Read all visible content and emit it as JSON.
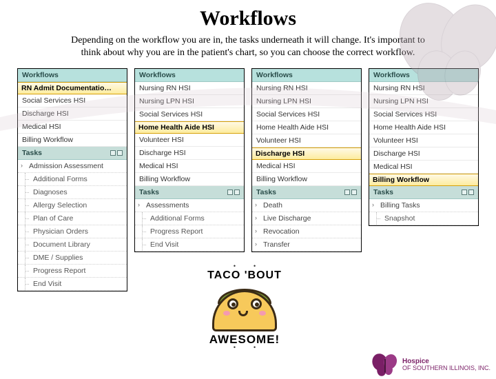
{
  "title": "Workflows",
  "subtitle": "Depending on the workflow you are in, the tasks underneath it will change. It's important to think about why you are in the patient's chart, so you can choose the correct workflow.",
  "labels": {
    "workflows": "Workflows",
    "tasks": "Tasks"
  },
  "panels": [
    {
      "workflows": [
        {
          "label": "RN Admit Documentatio…",
          "selected": true
        },
        {
          "label": "Social Services HSI"
        },
        {
          "label": "Discharge HSI"
        },
        {
          "label": "Medical HSI"
        },
        {
          "label": "Billing Workflow"
        }
      ],
      "tasks": [
        {
          "label": "Admission Assessment",
          "type": "caret"
        },
        {
          "label": "Additional Forms",
          "type": "sub"
        },
        {
          "label": "Diagnoses",
          "type": "sub"
        },
        {
          "label": "Allergy Selection",
          "type": "sub"
        },
        {
          "label": "Plan of Care",
          "type": "sub"
        },
        {
          "label": "Physician Orders",
          "type": "sub"
        },
        {
          "label": "Document Library",
          "type": "sub"
        },
        {
          "label": "DME / Supplies",
          "type": "sub"
        },
        {
          "label": "Progress Report",
          "type": "sub"
        },
        {
          "label": "End Visit",
          "type": "sub"
        }
      ]
    },
    {
      "workflows": [
        {
          "label": "Nursing RN HSI"
        },
        {
          "label": "Nursing LPN HSI"
        },
        {
          "label": "Social Services HSI"
        },
        {
          "label": "Home Health Aide HSI",
          "selected": true
        },
        {
          "label": "Volunteer HSI"
        },
        {
          "label": "Discharge HSI"
        },
        {
          "label": "Medical HSI"
        },
        {
          "label": "Billing Workflow"
        }
      ],
      "tasks": [
        {
          "label": "Assessments",
          "type": "caret"
        },
        {
          "label": "Additional Forms",
          "type": "sub"
        },
        {
          "label": "Progress Report",
          "type": "sub"
        },
        {
          "label": "End Visit",
          "type": "sub"
        }
      ]
    },
    {
      "workflows": [
        {
          "label": "Nursing RN HSI"
        },
        {
          "label": "Nursing LPN HSI"
        },
        {
          "label": "Social Services HSI"
        },
        {
          "label": "Home Health Aide HSI"
        },
        {
          "label": "Volunteer HSI"
        },
        {
          "label": "Discharge HSI",
          "selected": true
        },
        {
          "label": "Medical HSI"
        },
        {
          "label": "Billing Workflow"
        }
      ],
      "tasks": [
        {
          "label": "Death",
          "type": "caret"
        },
        {
          "label": "Live Discharge",
          "type": "caret"
        },
        {
          "label": "Revocation",
          "type": "caret"
        },
        {
          "label": "Transfer",
          "type": "caret"
        }
      ]
    },
    {
      "workflows": [
        {
          "label": "Nursing RN HSI"
        },
        {
          "label": "Nursing LPN HSI"
        },
        {
          "label": "Social Services HSI"
        },
        {
          "label": "Home Health Aide HSI"
        },
        {
          "label": "Volunteer HSI"
        },
        {
          "label": "Discharge HSI"
        },
        {
          "label": "Medical HSI"
        },
        {
          "label": "Billing Workflow",
          "selected": true
        }
      ],
      "tasks": [
        {
          "label": "Billing Tasks",
          "type": "caret"
        },
        {
          "label": "Snapshot",
          "type": "sub"
        }
      ]
    }
  ],
  "taco": {
    "top": "TACO 'BOUT",
    "bottom": "AWESOME!"
  },
  "logo": {
    "name": "Hospice",
    "sub": "OF SOUTHERN ILLINOIS, INC."
  },
  "colors": {
    "brand": "#7a1f66"
  }
}
